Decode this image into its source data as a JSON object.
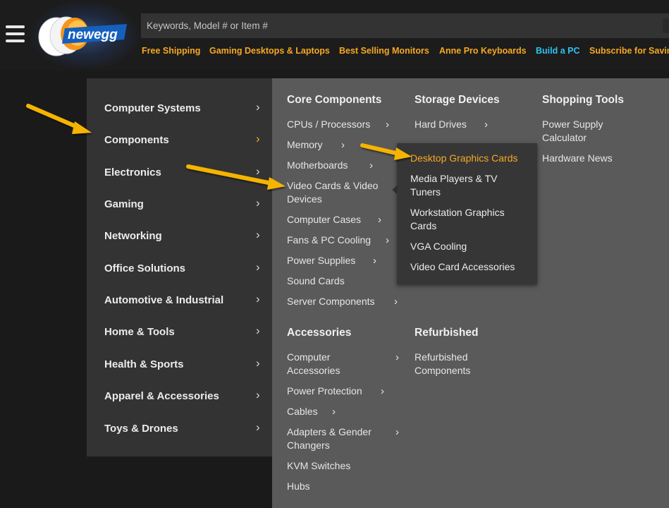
{
  "header": {
    "search_placeholder": "Keywords, Model # or Item #",
    "logo_text": "newegg",
    "promos": [
      {
        "label": "Free Shipping",
        "color": "#f7a823"
      },
      {
        "label": "Gaming Desktops & Laptops",
        "color": "#f7a823"
      },
      {
        "label": "Best Selling Monitors",
        "color": "#f7a823"
      },
      {
        "label": "Anne Pro Keyboards",
        "color": "#f7a823"
      },
      {
        "label": "Build a PC",
        "color": "#2ec4f2"
      },
      {
        "label": "Subscribe for Savin",
        "color": "#f7a823"
      }
    ]
  },
  "left_menu": {
    "items": [
      {
        "label": "Computer Systems",
        "chevron": "›"
      },
      {
        "label": "Components",
        "chevron": "›",
        "active": true
      },
      {
        "label": "Electronics",
        "chevron": "›"
      },
      {
        "label": "Gaming",
        "chevron": "›"
      },
      {
        "label": "Networking",
        "chevron": "›"
      },
      {
        "label": "Office Solutions",
        "chevron": "›"
      },
      {
        "label": "Automotive & Industrial",
        "chevron": "›"
      },
      {
        "label": "Home & Tools",
        "chevron": "›"
      },
      {
        "label": "Health & Sports",
        "chevron": "›"
      },
      {
        "label": "Apparel & Accessories",
        "chevron": "›"
      },
      {
        "label": "Toys & Drones",
        "chevron": "›"
      }
    ]
  },
  "panel": {
    "core": {
      "heading": "Core Components",
      "items": [
        {
          "label": "CPUs / Processors",
          "chevron": "›"
        },
        {
          "label": "Memory",
          "chevron": "›"
        },
        {
          "label": "Motherboards",
          "chevron": "›"
        },
        {
          "label": "Video Cards & Video Devices",
          "chevron": ""
        },
        {
          "label": "Computer Cases",
          "chevron": "›"
        },
        {
          "label": "Fans & PC Cooling",
          "chevron": "›"
        },
        {
          "label": "Power Supplies",
          "chevron": "›"
        },
        {
          "label": "Sound Cards",
          "chevron": ""
        },
        {
          "label": "Server Components",
          "chevron": "›"
        }
      ]
    },
    "storage": {
      "heading": "Storage Devices",
      "items": [
        {
          "label": "Hard Drives",
          "chevron": "›"
        }
      ]
    },
    "tools": {
      "heading": "Shopping Tools",
      "items": [
        {
          "label": "Power Supply Calculator"
        },
        {
          "label": "Hardware News"
        }
      ]
    },
    "accessories": {
      "heading": "Accessories",
      "items": [
        {
          "label": "Computer Accessories",
          "chevron": "›"
        },
        {
          "label": "Power Protection",
          "chevron": "›"
        },
        {
          "label": "Cables",
          "chevron": "›"
        },
        {
          "label": "Adapters & Gender Changers",
          "chevron": "›"
        },
        {
          "label": "KVM Switches",
          "chevron": ""
        },
        {
          "label": "Hubs",
          "chevron": ""
        }
      ]
    },
    "refurbished": {
      "heading": "Refurbished",
      "items": [
        {
          "label": "Refurbished Components",
          "chevron": "›"
        }
      ]
    }
  },
  "flyout": {
    "items": [
      {
        "label": "Desktop Graphics Cards",
        "highlighted": true
      },
      {
        "label": "Media Players & TV Tuners"
      },
      {
        "label": "Workstation Graphics Cards"
      },
      {
        "label": "VGA Cooling"
      },
      {
        "label": "Video Card Accessories"
      }
    ]
  },
  "colors": {
    "accent": "#f7a823",
    "link_blue": "#2ec4f2",
    "menu_bg": "#333333",
    "panel_bg": "#5a5a5a",
    "annotation_arrow": "#f5b400"
  }
}
